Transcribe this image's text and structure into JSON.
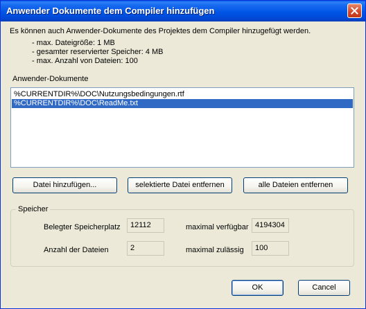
{
  "window": {
    "title": "Anwender Dokumente dem Compiler hinzufügen"
  },
  "intro": {
    "text": "Es können auch Anwender-Dokumente des Projektes dem Compiler hinzugefügt werden.",
    "limits": [
      "- max. Dateigröße: 1 MB",
      "- gesamter reservierter Speicher: 4 MB",
      "- max. Anzahl von Dateien: 100"
    ]
  },
  "documents": {
    "label": "Anwender-Dokumente",
    "items": [
      {
        "text": "%CURRENTDIR%\\DOC\\Nutzungsbedingungen.rtf",
        "selected": false
      },
      {
        "text": "%CURRENTDIR%\\DOC\\ReadMe.txt",
        "selected": true
      }
    ]
  },
  "actions": {
    "add": "Datei hinzufügen...",
    "remove_selected": "selektierte Datei entfernen",
    "remove_all": "alle Dateien entfernen"
  },
  "memory": {
    "legend": "Speicher",
    "used_label": "Belegter Speicherplatz",
    "used_value": "12112",
    "available_label": "maximal verfügbar",
    "available_value": "4194304",
    "count_label": "Anzahl der Dateien",
    "count_value": "2",
    "max_label": "maximal zulässig",
    "max_value": "100"
  },
  "footer": {
    "ok": "OK",
    "cancel": "Cancel"
  },
  "colors": {
    "titlebar": "#0055e5",
    "selection": "#316ac5",
    "dialog_bg": "#ece9d8"
  }
}
